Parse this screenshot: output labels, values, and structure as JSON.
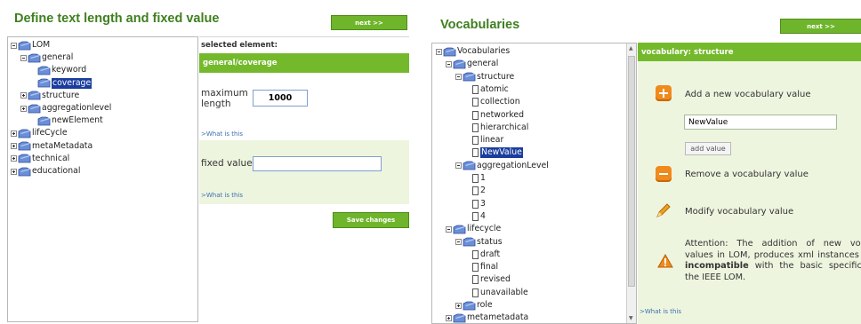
{
  "left": {
    "title": "Define text length and fixed value",
    "next_label": "next >>",
    "tree": [
      {
        "label": "LOM",
        "icon": "folder",
        "exp": "minus",
        "lvl": 0
      },
      {
        "label": "general",
        "icon": "folder",
        "exp": "minus",
        "lvl": 1
      },
      {
        "label": "keyword",
        "icon": "folder",
        "exp": "",
        "lvl": 2
      },
      {
        "label": "coverage",
        "icon": "folder",
        "exp": "",
        "lvl": 2,
        "selected": true
      },
      {
        "label": "structure",
        "icon": "folder",
        "exp": "plus",
        "lvl": 1
      },
      {
        "label": "aggregationlevel",
        "icon": "folder",
        "exp": "plus",
        "lvl": 1
      },
      {
        "label": "newElement",
        "icon": "folder",
        "exp": "",
        "lvl": 2
      },
      {
        "label": "lifeCycle",
        "icon": "folder",
        "exp": "plus",
        "lvl": 0
      },
      {
        "label": "metaMetadata",
        "icon": "folder",
        "exp": "plus",
        "lvl": 0
      },
      {
        "label": "technical",
        "icon": "folder",
        "exp": "plus",
        "lvl": 0
      },
      {
        "label": "educational",
        "icon": "folder",
        "exp": "plus",
        "lvl": 0
      }
    ],
    "selected_element_label": "selected element:",
    "selected_element_value": "general/coverage",
    "max_length_label": "maximum length",
    "max_length_value": "1000",
    "what_is_this_1": ">What is this",
    "fixed_value_label": "fixed value",
    "fixed_value_value": "",
    "what_is_this_2": ">What is this",
    "save_label": "Save changes"
  },
  "right": {
    "title": "Vocabularies",
    "next_label": "next >>",
    "tree": [
      {
        "label": "Vocabularies",
        "icon": "folder",
        "exp": "minus",
        "lvl": 0
      },
      {
        "label": "general",
        "icon": "folder",
        "exp": "minus",
        "lvl": 1
      },
      {
        "label": "structure",
        "icon": "folder",
        "exp": "minus",
        "lvl": 2
      },
      {
        "label": "atomic",
        "icon": "doc",
        "exp": "",
        "lvl": 3
      },
      {
        "label": "collection",
        "icon": "doc",
        "exp": "",
        "lvl": 3
      },
      {
        "label": "networked",
        "icon": "doc",
        "exp": "",
        "lvl": 3
      },
      {
        "label": "hierarchical",
        "icon": "doc",
        "exp": "",
        "lvl": 3
      },
      {
        "label": "linear",
        "icon": "doc",
        "exp": "",
        "lvl": 3
      },
      {
        "label": "NewValue",
        "icon": "doc",
        "exp": "",
        "lvl": 3,
        "selected": true
      },
      {
        "label": "aggregationLevel",
        "icon": "folder",
        "exp": "minus",
        "lvl": 2
      },
      {
        "label": "1",
        "icon": "doc",
        "exp": "",
        "lvl": 3
      },
      {
        "label": "2",
        "icon": "doc",
        "exp": "",
        "lvl": 3
      },
      {
        "label": "3",
        "icon": "doc",
        "exp": "",
        "lvl": 3
      },
      {
        "label": "4",
        "icon": "doc",
        "exp": "",
        "lvl": 3
      },
      {
        "label": "lifecycle",
        "icon": "folder",
        "exp": "minus",
        "lvl": 1
      },
      {
        "label": "status",
        "icon": "folder",
        "exp": "minus",
        "lvl": 2
      },
      {
        "label": "draft",
        "icon": "doc",
        "exp": "",
        "lvl": 3
      },
      {
        "label": "final",
        "icon": "doc",
        "exp": "",
        "lvl": 3
      },
      {
        "label": "revised",
        "icon": "doc",
        "exp": "",
        "lvl": 3
      },
      {
        "label": "unavailable",
        "icon": "doc",
        "exp": "",
        "lvl": 3
      },
      {
        "label": "role",
        "icon": "folder",
        "exp": "plus",
        "lvl": 2
      },
      {
        "label": "metametadata",
        "icon": "folder",
        "exp": "plus",
        "lvl": 1
      }
    ],
    "header": "vocabulary: structure",
    "add_title": "Add a new vocabulary value",
    "add_input_value": "NewValue",
    "add_button_label": "add value",
    "remove_label": "Remove a vocabulary value",
    "modify_label": "Modify vocabulary value",
    "attention_1": "Attention: The addition of new vocabulary values in LOM, produces xml instances that are ",
    "attention_bold": "incompatible",
    "attention_2": " with the basic specification of the IEEE LOM.",
    "what_is_this": ">What is this"
  },
  "colors": {
    "accent_green": "#74b92b",
    "heading_green": "#3f7f1f",
    "selection_blue": "#1a3d9e",
    "panel_bg": "#eef5df"
  }
}
